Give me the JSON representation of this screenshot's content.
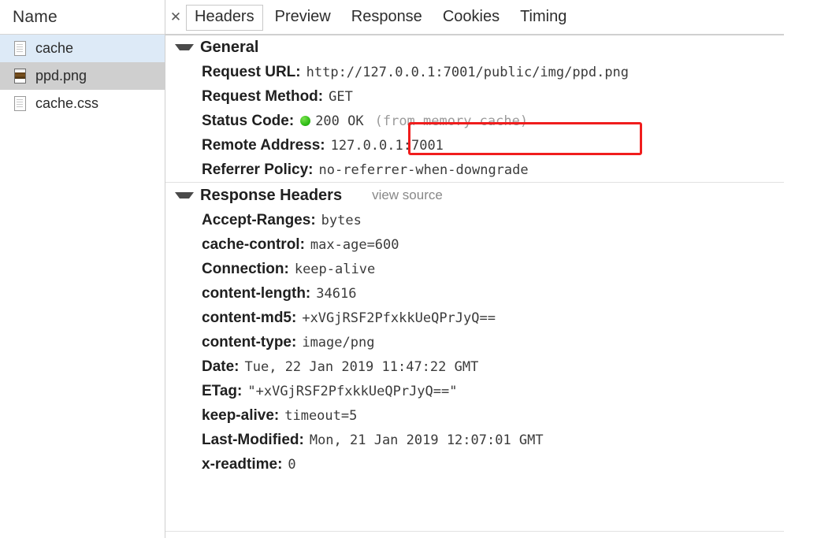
{
  "sidebar": {
    "column_header": "Name",
    "files": [
      {
        "name": "cache",
        "icon": "document-icon",
        "state": "selected-secondary"
      },
      {
        "name": "ppd.png",
        "icon": "image-file-icon",
        "state": "selected"
      },
      {
        "name": "cache.css",
        "icon": "document-icon",
        "state": "normal"
      }
    ]
  },
  "detail": {
    "close_label": "✕",
    "tabs": [
      {
        "label": "Headers",
        "active": true
      },
      {
        "label": "Preview",
        "active": false
      },
      {
        "label": "Response",
        "active": false
      },
      {
        "label": "Cookies",
        "active": false
      },
      {
        "label": "Timing",
        "active": false
      }
    ],
    "general": {
      "title": "General",
      "rows": [
        {
          "key": "Request URL:",
          "value": "http://127.0.0.1:7001/public/img/ppd.png"
        },
        {
          "key": "Request Method:",
          "value": "GET"
        },
        {
          "key": "Status Code:",
          "value": "200 OK",
          "status_dot": true,
          "suffix": "(from memory cache)"
        },
        {
          "key": "Remote Address:",
          "value": "127.0.0.1:7001"
        },
        {
          "key": "Referrer Policy:",
          "value": "no-referrer-when-downgrade"
        }
      ]
    },
    "response_headers": {
      "title": "Response Headers",
      "view_source": "view source",
      "rows": [
        {
          "key": "Accept-Ranges:",
          "value": "bytes"
        },
        {
          "key": "cache-control:",
          "value": "max-age=600"
        },
        {
          "key": "Connection:",
          "value": "keep-alive"
        },
        {
          "key": "content-length:",
          "value": "34616"
        },
        {
          "key": "content-md5:",
          "value": "+xVGjRSF2PfxkkUeQPrJyQ=="
        },
        {
          "key": "content-type:",
          "value": "image/png"
        },
        {
          "key": "Date:",
          "value": "Tue, 22 Jan 2019 11:47:22 GMT"
        },
        {
          "key": "ETag:",
          "value": "\"+xVGjRSF2PfxkkUeQPrJyQ==\""
        },
        {
          "key": "keep-alive:",
          "value": "timeout=5"
        },
        {
          "key": "Last-Modified:",
          "value": "Mon, 21 Jan 2019 12:07:01 GMT"
        },
        {
          "key": "x-readtime:",
          "value": "0"
        }
      ]
    }
  },
  "annotation": {
    "highlight_color": "#f01d1d",
    "highlight_target": "(from memory cache)"
  },
  "colors": {
    "status_ok": "#2fbd16",
    "selected_row": "#cfcfcf",
    "secondary_row": "#ddeaf7"
  }
}
